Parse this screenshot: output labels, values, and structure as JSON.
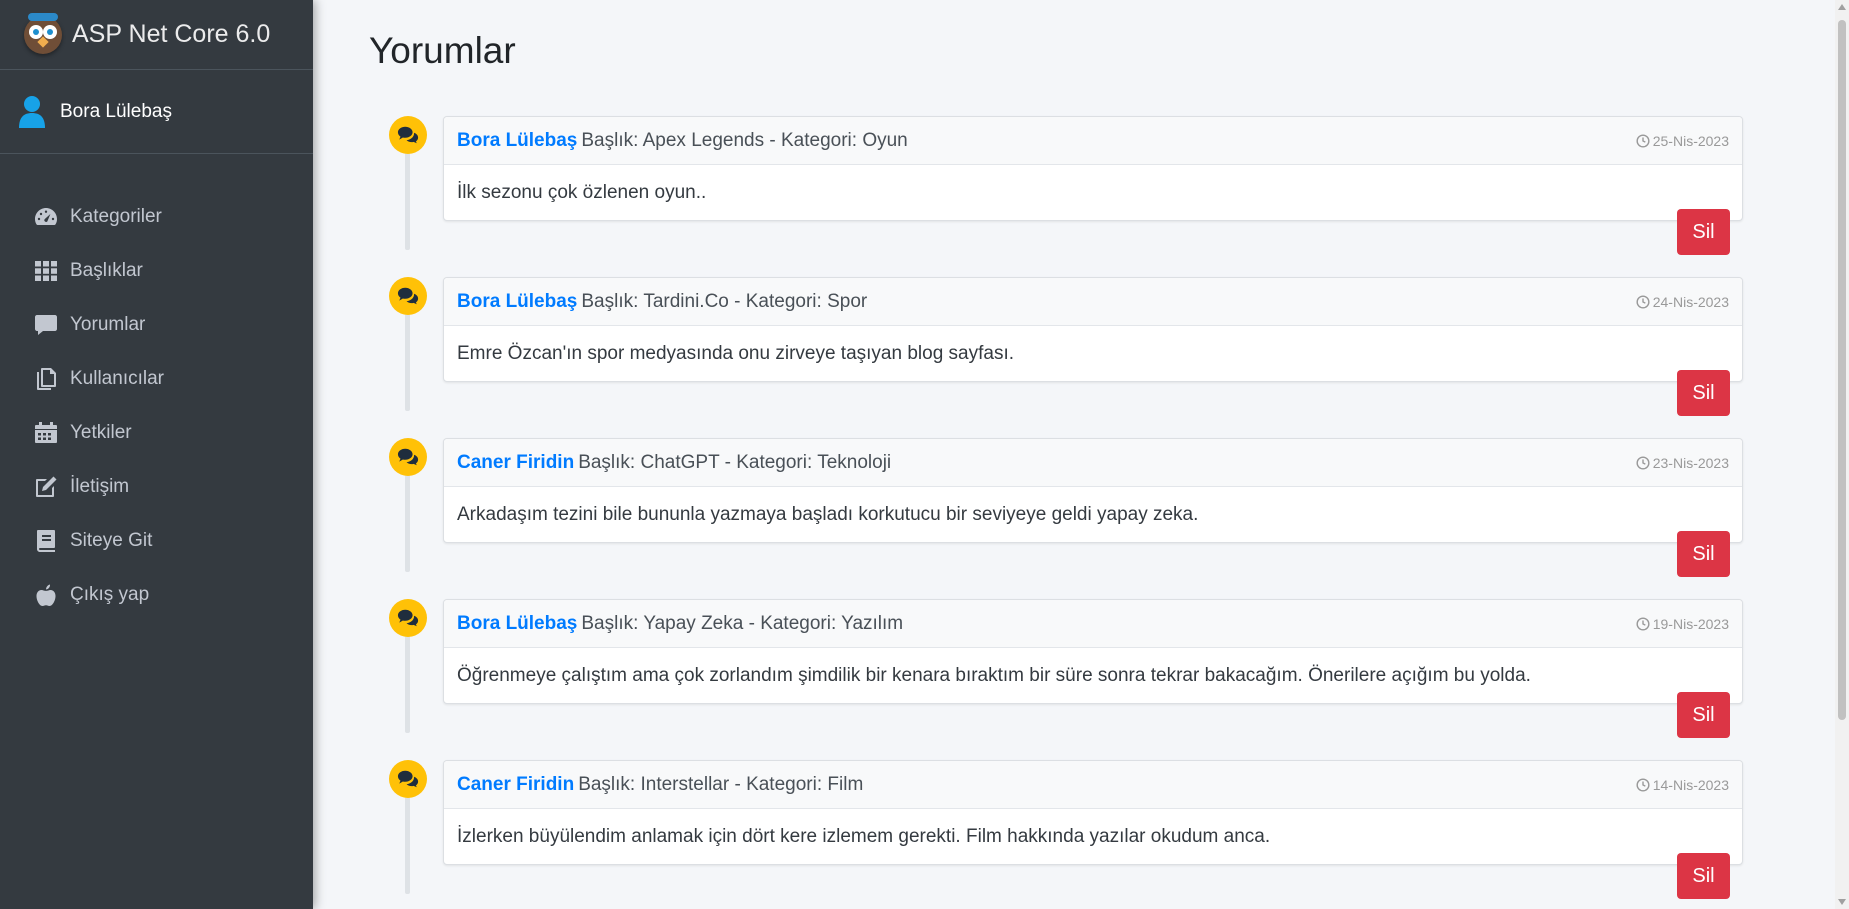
{
  "brand": {
    "title": "ASP Net Core 6.0"
  },
  "user": {
    "name": "Bora Lülebaş"
  },
  "sidebar": {
    "items": [
      {
        "label": "Kategoriler",
        "icon": "tachometer-icon"
      },
      {
        "label": "Başlıklar",
        "icon": "grid-icon"
      },
      {
        "label": "Yorumlar",
        "icon": "comment-icon"
      },
      {
        "label": "Kullanıcılar",
        "icon": "copy-icon"
      },
      {
        "label": "Yetkiler",
        "icon": "calendar-icon"
      },
      {
        "label": "İletişim",
        "icon": "edit-icon"
      },
      {
        "label": "Siteye Git",
        "icon": "book-icon"
      },
      {
        "label": "Çıkış yap",
        "icon": "apple-icon"
      }
    ]
  },
  "page": {
    "title": "Yorumlar"
  },
  "comments": [
    {
      "author": "Bora Lülebaş",
      "meta": "Başlık: Apex Legends - Kategori: Oyun",
      "date": "25-Nis-2023",
      "text": "İlk sezonu çok özlenen oyun..",
      "delete_label": "Sil"
    },
    {
      "author": "Bora Lülebaş",
      "meta": "Başlık: Tardini.Co - Kategori: Spor",
      "date": "24-Nis-2023",
      "text": "Emre Özcan'ın spor medyasında onu zirveye taşıyan blog sayfası.",
      "delete_label": "Sil"
    },
    {
      "author": "Caner Firidin",
      "meta": "Başlık: ChatGPT - Kategori: Teknoloji",
      "date": "23-Nis-2023",
      "text": "Arkadaşım tezini bile bununla yazmaya başladı korkutucu bir seviyeye geldi yapay zeka.",
      "delete_label": "Sil"
    },
    {
      "author": "Bora Lülebaş",
      "meta": "Başlık: Yapay Zeka - Kategori: Yazılım",
      "date": "19-Nis-2023",
      "text": "Öğrenmeye çalıştım ama çok zorlandım şimdilik bir kenara bıraktım bir süre sonra tekrar bakacağım. Önerilere açığım bu yolda.",
      "delete_label": "Sil"
    },
    {
      "author": "Caner Firidin",
      "meta": "Başlık: Interstellar - Kategori: Film",
      "date": "14-Nis-2023",
      "text": "İzlerken büyülendim anlamak için dört kere izlemem gerekti. Film hakkında yazılar okudum anca.",
      "delete_label": "Sil"
    }
  ],
  "colors": {
    "sidebar_bg": "#343a40",
    "accent": "#007bff",
    "badge": "#ffc107",
    "danger": "#dc3545"
  }
}
